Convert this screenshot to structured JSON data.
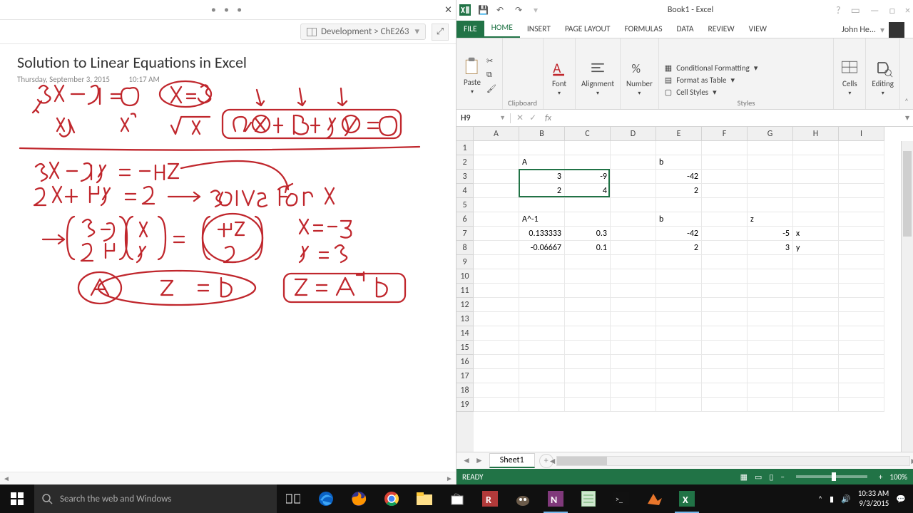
{
  "onenote": {
    "breadcrumb": "Development > ChE263",
    "title": "Solution to Linear Equations in Excel",
    "date": "Thursday, September 3, 2015",
    "time": "10:17 AM"
  },
  "excel": {
    "title": "Book1 - Excel",
    "user": "John He...",
    "tabs": {
      "file": "FILE",
      "home": "HOME",
      "insert": "INSERT",
      "page_layout": "PAGE LAYOUT",
      "formulas": "FORMULAS",
      "data": "DATA",
      "review": "REVIEW",
      "view": "VIEW"
    },
    "ribbon": {
      "paste": "Paste",
      "clipboard": "Clipboard",
      "font": "Font",
      "alignment": "Alignment",
      "number": "Number",
      "cond_fmt": "Conditional Formatting",
      "as_table": "Format as Table",
      "cell_styles": "Cell Styles",
      "styles": "Styles",
      "cells": "Cells",
      "editing": "Editing"
    },
    "namebox": "H9",
    "columns": [
      "A",
      "B",
      "C",
      "D",
      "E",
      "F",
      "G",
      "H",
      "I"
    ],
    "rows": 19,
    "data": {
      "B2": {
        "v": "A",
        "t": "s"
      },
      "E2": {
        "v": "b",
        "t": "s"
      },
      "B3": {
        "v": "3",
        "t": "n"
      },
      "C3": {
        "v": "-9",
        "t": "n"
      },
      "E3": {
        "v": "-42",
        "t": "n"
      },
      "B4": {
        "v": "2",
        "t": "n"
      },
      "C4": {
        "v": "4",
        "t": "n"
      },
      "E4": {
        "v": "2",
        "t": "n"
      },
      "B6": {
        "v": "A^-1",
        "t": "s"
      },
      "E6": {
        "v": "b",
        "t": "s"
      },
      "G6": {
        "v": "z",
        "t": "s"
      },
      "B7": {
        "v": "0.133333",
        "t": "n"
      },
      "C7": {
        "v": "0.3",
        "t": "n"
      },
      "E7": {
        "v": "-42",
        "t": "n"
      },
      "G7": {
        "v": "-5",
        "t": "n"
      },
      "H7": {
        "v": "x",
        "t": "s"
      },
      "B8": {
        "v": "-0.06667",
        "t": "n"
      },
      "C8": {
        "v": "0.1",
        "t": "n"
      },
      "E8": {
        "v": "2",
        "t": "n"
      },
      "G8": {
        "v": "3",
        "t": "n"
      },
      "H8": {
        "v": "y",
        "t": "s"
      }
    },
    "selection_box": {
      "c1": 1,
      "r1": 2,
      "c2": 2,
      "r2": 3
    },
    "sheet": "Sheet1",
    "status": "READY",
    "zoom": "100%"
  },
  "taskbar": {
    "search_placeholder": "Search the web and Windows",
    "clock_time": "10:33 AM",
    "clock_date": "9/3/2015"
  }
}
